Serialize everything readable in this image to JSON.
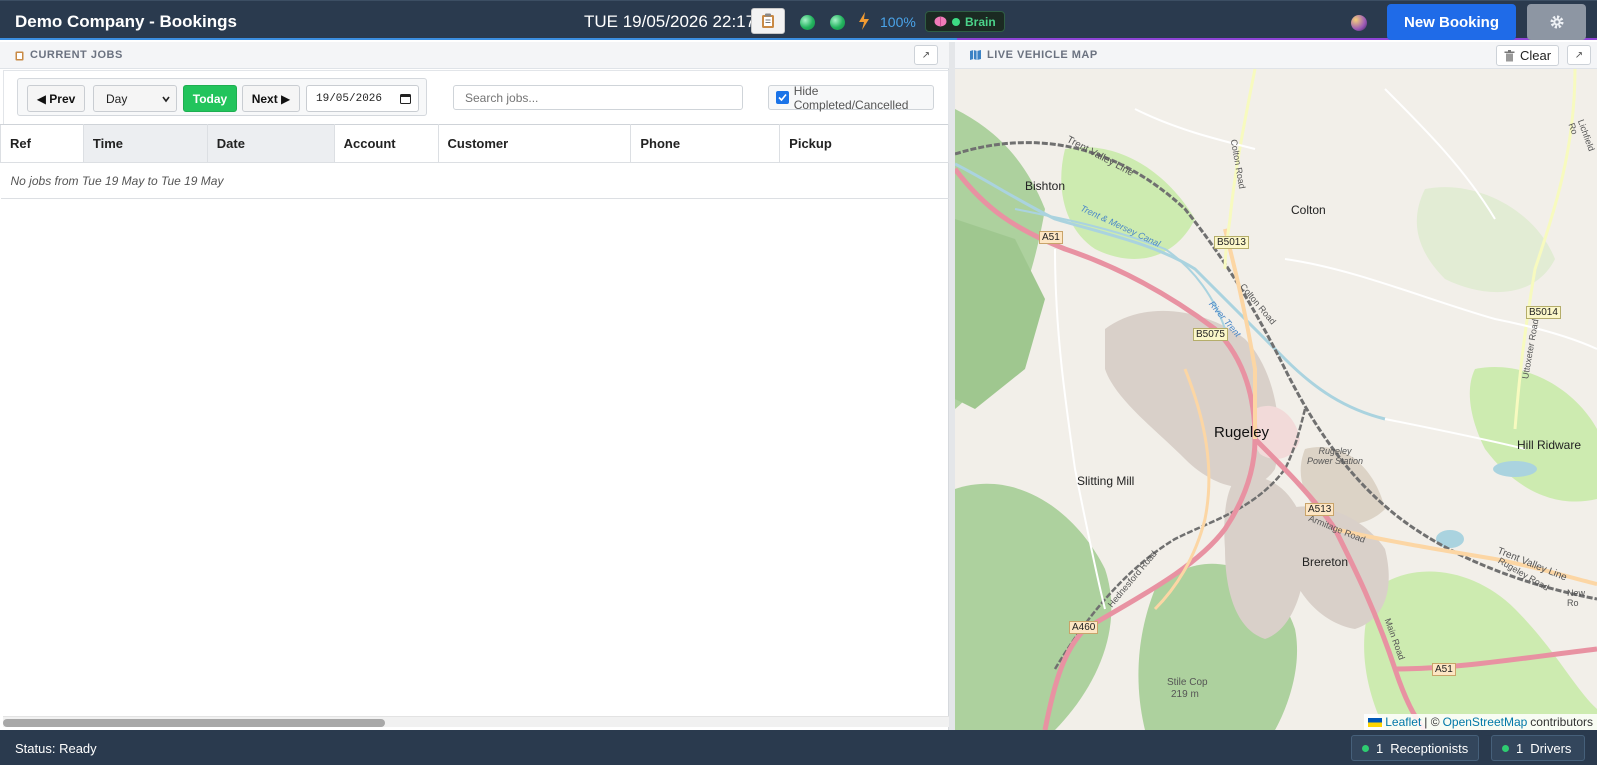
{
  "header": {
    "title": "Demo Company - Bookings",
    "datetime": "TUE 19/05/2026 22:17",
    "percent": "100%",
    "brain_label": "Brain",
    "new_booking_label": "New Booking"
  },
  "jobs_panel": {
    "title": "CURRENT JOBS",
    "prev_label": "◀ Prev",
    "view_selected": "Day",
    "today_label": "Today",
    "next_label": "Next ▶",
    "date_value": "19/05/2026",
    "search_placeholder": "Search jobs...",
    "hide_label": "Hide Completed/Cancelled",
    "hide_checked": true,
    "columns": [
      "Ref",
      "Time",
      "Date",
      "Account",
      "Customer",
      "Phone",
      "Pickup"
    ],
    "empty_message": "No jobs from Tue 19 May to Tue 19 May"
  },
  "map_panel": {
    "title": "LIVE VEHICLE MAP",
    "clear_label": "Clear",
    "labels": {
      "bishton": "Bishton",
      "colton": "Colton",
      "rugeley": "Rugeley",
      "slitting_mill": "Slitting Mill",
      "hill_ridware": "Hill Ridware",
      "brereton": "Brereton",
      "power_station": "Rugeley Power Station",
      "stile_cop": "Stile Cop",
      "stile_cop_height": "219 m",
      "trent_valley_line": "Trent Valley Line",
      "trent_mersey_canal": "Trent & Mersey Canal",
      "river_trent": "River Trent",
      "colton_road": "Colton Road",
      "armitage_road": "Armitage Road",
      "hednesford_road": "Hednesford Road",
      "main_road": "Main Road",
      "uttoxeter_road": "Uttoxeter Road",
      "rugeley_road": "Rugeley Road",
      "new_road": "New Ro",
      "lichfield_road": "Lichfield Ro"
    },
    "road_refs": {
      "a51_west": "A51",
      "b5013": "B5013",
      "b5075": "B5075",
      "b5014": "B5014",
      "a513": "A513",
      "a460": "A460",
      "a51_east": "A51"
    },
    "attribution": {
      "leaflet": "Leaflet",
      "separator": "| ©",
      "osm": "OpenStreetMap",
      "suffix": "contributors"
    }
  },
  "statusbar": {
    "status": "Status: Ready",
    "receptionists_count": "1",
    "receptionists_label": "Receptionists",
    "drivers_count": "1",
    "drivers_label": "Drivers"
  },
  "colors": {
    "header_bg": "#2a3a4e",
    "accent_blue": "#1f6be8",
    "today_green": "#22c45c",
    "online_green": "#2ecc71"
  }
}
